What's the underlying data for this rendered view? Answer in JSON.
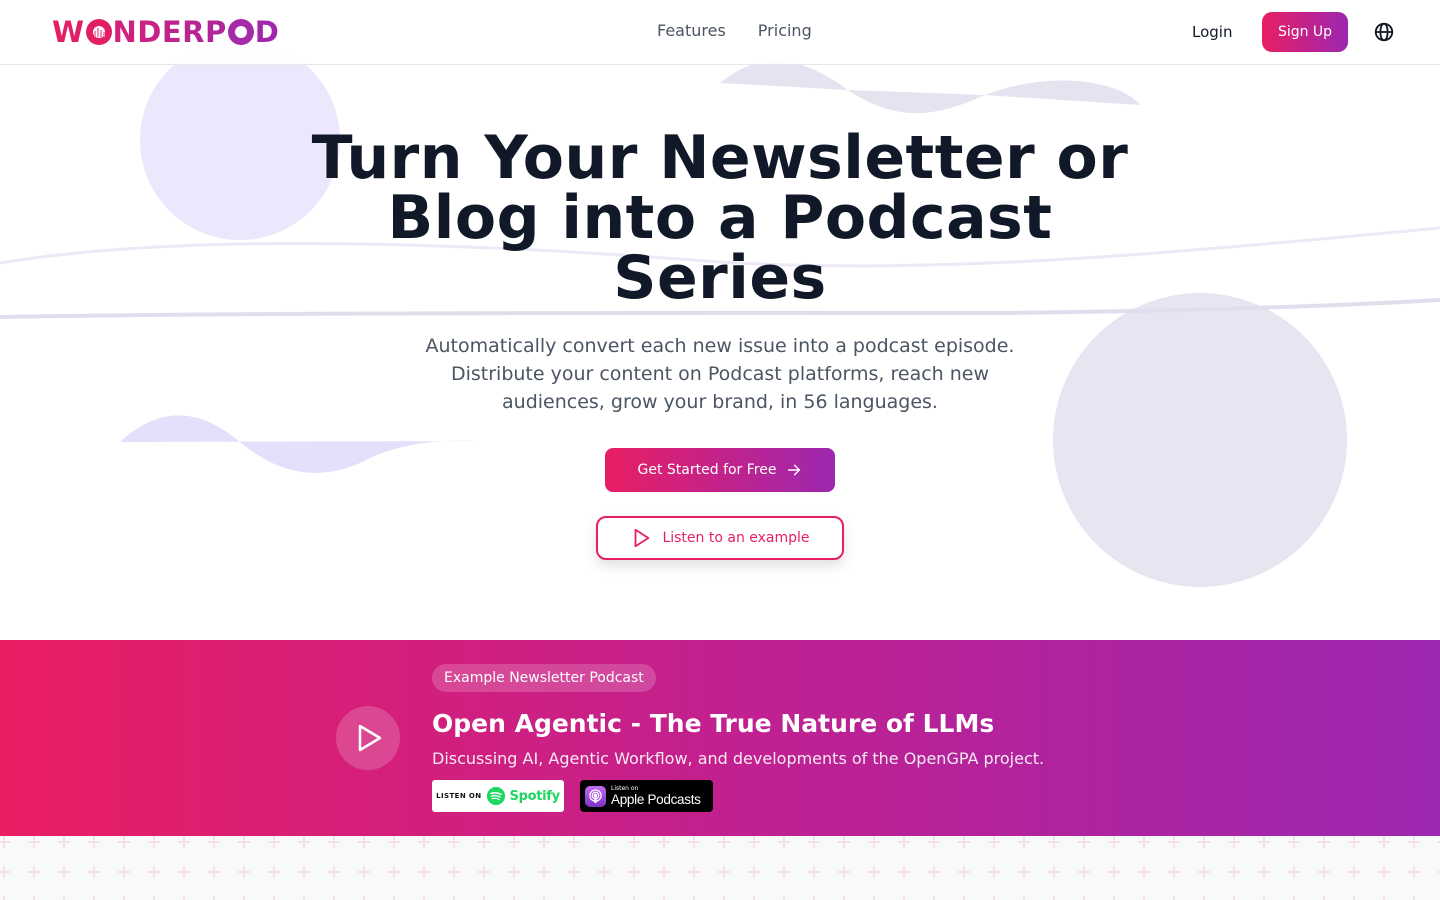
{
  "brand": {
    "name_prefix": "W",
    "name_middle": "NDERP",
    "name_suffix": "D",
    "full_name": "WONDERPOD",
    "gradient_start": "#e91e63",
    "gradient_end": "#9c27b0"
  },
  "header": {
    "nav": [
      {
        "label": "Features"
      },
      {
        "label": "Pricing"
      }
    ],
    "login_label": "Login",
    "signup_label": "Sign Up",
    "language_icon": "globe-icon"
  },
  "hero": {
    "title_lines": [
      "Turn Your Newsletter or",
      "Blog into a Podcast",
      "Series"
    ],
    "subtitle_lines": [
      "Automatically convert each new issue into a podcast episode.",
      "Distribute your content on Podcast platforms, reach new",
      "audiences, grow your brand, in 56 languages."
    ],
    "cta_label": "Get Started for Free",
    "cta_icon": "arrow-right-icon",
    "listen_label": "Listen to an example",
    "listen_icon": "play-icon"
  },
  "example": {
    "badge": "Example Newsletter Podcast",
    "title": "Open Agentic - The True Nature of LLMs",
    "description": "Discussing AI, Agentic Workflow, and developments of the OpenGPA project.",
    "spotify": {
      "prefix": "LISTEN ON",
      "name": "Spotify"
    },
    "apple": {
      "prefix": "Listen on",
      "name": "Apple Podcasts"
    }
  },
  "colors": {
    "accent_pink": "#e91e63",
    "accent_purple": "#9c27b0",
    "heading": "#111827",
    "body_text": "#4b5563",
    "decor_lavender": "#ede8fb"
  }
}
